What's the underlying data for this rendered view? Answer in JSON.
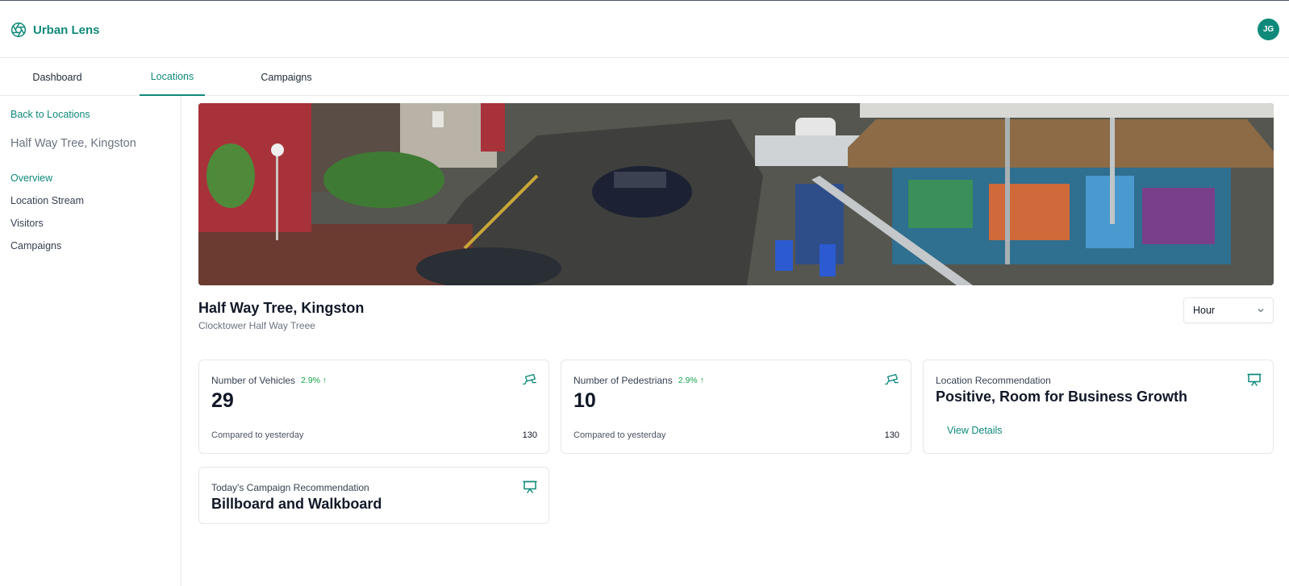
{
  "app": {
    "name": "Urban Lens",
    "logo_icon": "aperture-icon",
    "accent": "#0f8a7a",
    "user_initials": "JG"
  },
  "tabs": [
    {
      "label": "Dashboard",
      "active": false
    },
    {
      "label": "Locations",
      "active": true
    },
    {
      "label": "Campaigns",
      "active": false
    }
  ],
  "sidebar": {
    "back_label": "Back to Locations",
    "location_title": "Half Way Tree, Kingston",
    "items": [
      {
        "label": "Overview",
        "active": true
      },
      {
        "label": "Location Stream",
        "active": false
      },
      {
        "label": "Visitors",
        "active": false
      },
      {
        "label": "Campaigns",
        "active": false
      }
    ]
  },
  "location": {
    "title": "Half Way Tree, Kingston",
    "subtitle": "Clocktower Half Way Treee",
    "time_filter": "Hour"
  },
  "cards": {
    "vehicles": {
      "label": "Number of Vehicles",
      "trend": "2.9% ↑",
      "value": "29",
      "compare_label": "Compared to yesterday",
      "compare_value": "130",
      "icon": "cctv-camera-icon"
    },
    "pedestrians": {
      "label": "Number of Pedestrians",
      "trend": "2.9% ↑",
      "value": "10",
      "compare_label": "Compared to yesterday",
      "compare_value": "130",
      "icon": "cctv-camera-icon"
    },
    "location_rec": {
      "label": "Location Recommendation",
      "headline": "Positive, Room for Business Growth",
      "link": "View Details",
      "icon": "presentation-icon"
    },
    "campaign_rec": {
      "label": "Today's Campaign Recommendation",
      "headline": "Billboard and Walkboard",
      "icon": "presentation-icon"
    }
  }
}
